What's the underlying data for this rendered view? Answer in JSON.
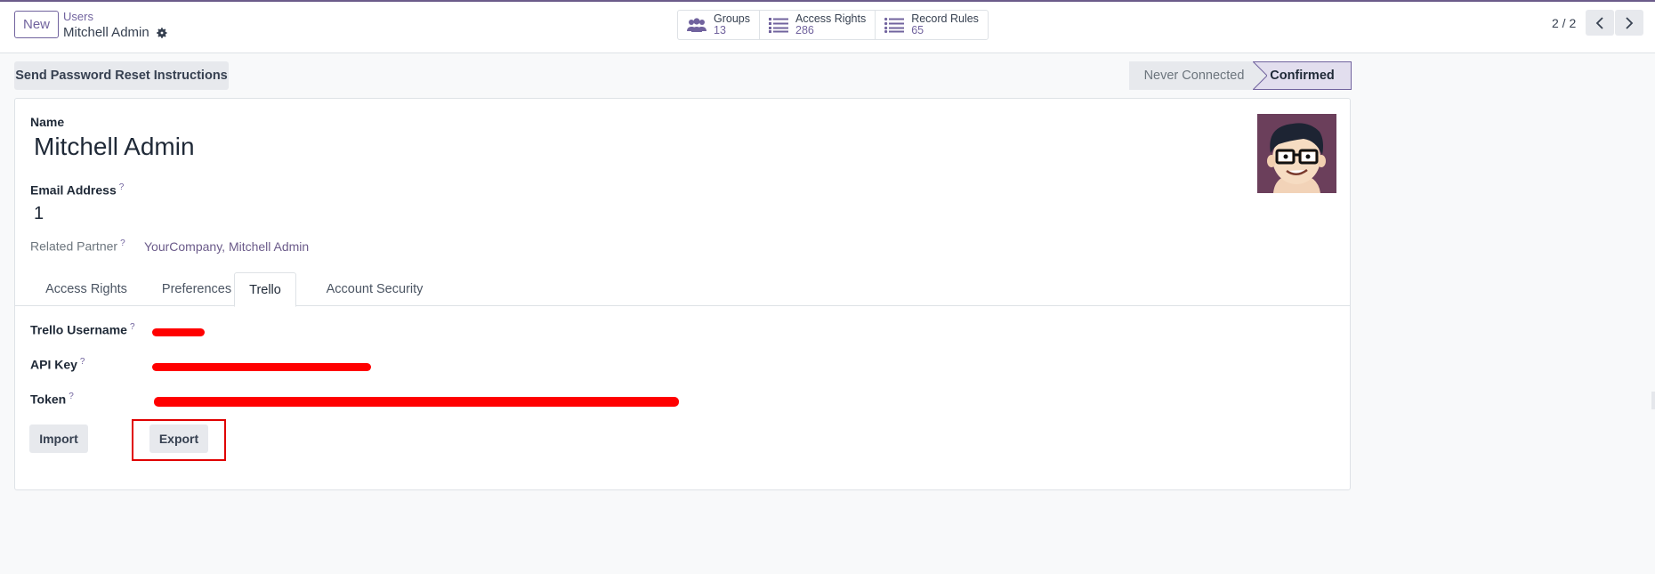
{
  "toolbar": {
    "new_label": "New",
    "breadcrumb_parent": "Users",
    "breadcrumb_current": "Mitchell Admin"
  },
  "smart_buttons": [
    {
      "label": "Groups",
      "value": "13",
      "icon": "users-icon"
    },
    {
      "label": "Access Rights",
      "value": "286",
      "icon": "list-icon"
    },
    {
      "label": "Record Rules",
      "value": "65",
      "icon": "list-icon"
    }
  ],
  "pager": {
    "text": "2 / 2"
  },
  "actions": {
    "reset_password_label": "Send Password Reset Instructions"
  },
  "statusbar": {
    "stages": [
      "Never Connected",
      "Confirmed"
    ],
    "active": "Confirmed"
  },
  "form": {
    "name_label": "Name",
    "name_value": "Mitchell Admin",
    "email_label": "Email Address",
    "email_value": "1",
    "partner_label": "Related Partner",
    "partner_value": "YourCompany, Mitchell Admin",
    "help_mark": "?"
  },
  "tabs": [
    {
      "label": "Access Rights"
    },
    {
      "label": "Preferences"
    },
    {
      "label": "Trello"
    },
    {
      "label": "Account Security"
    }
  ],
  "active_tab": "Trello",
  "trello": {
    "username_label": "Trello Username",
    "api_key_label": "API Key",
    "token_label": "Token",
    "import_label": "Import",
    "export_label": "Export"
  },
  "colors": {
    "brand": "#71639e",
    "redaction": "#ff0000"
  }
}
